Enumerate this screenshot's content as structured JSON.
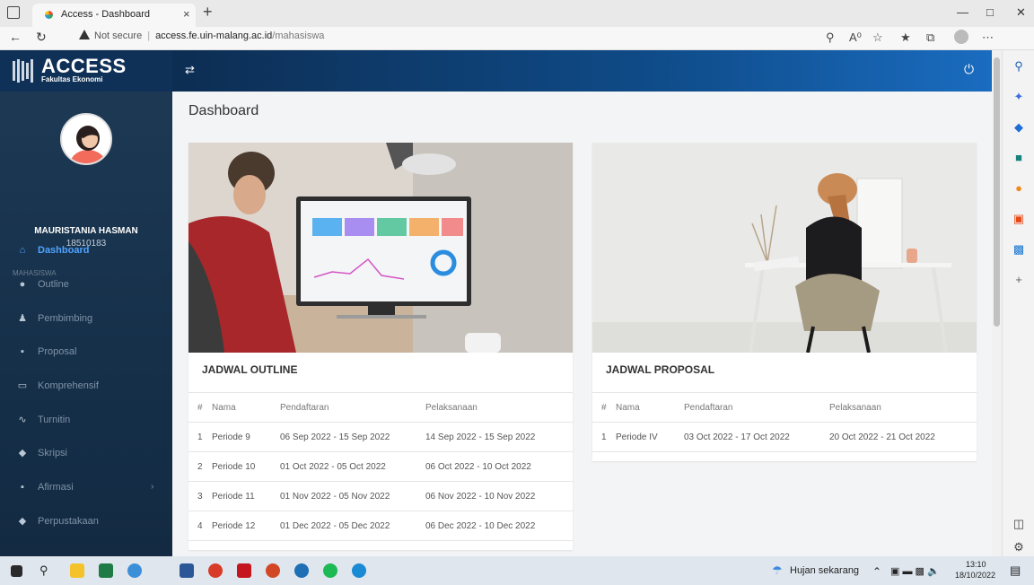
{
  "browser": {
    "tab_title": "Access - Dashboard",
    "new_tab": "+",
    "close_tab": "×",
    "not_secure": "Not secure",
    "url_host": "access.fe.uin-malang.ac.id",
    "url_path": "/mahasiswa"
  },
  "app": {
    "logo_title": "ACCESS",
    "logo_subtitle": "Fakultas Ekonomi",
    "page_title": "Dashboard"
  },
  "user": {
    "name": "MAURISTANIA HASMAN",
    "id": "18510183"
  },
  "sidebar": {
    "section_label": "MAHASISWA",
    "items": [
      {
        "label": "Dashboard",
        "icon": "home-icon",
        "glyph": "⌂"
      },
      {
        "label": "Outline",
        "icon": "circle-icon",
        "glyph": "●"
      },
      {
        "label": "Pembimbing",
        "icon": "user-icon",
        "glyph": "♟"
      },
      {
        "label": "Proposal",
        "icon": "document-icon",
        "glyph": "▪"
      },
      {
        "label": "Komprehensif",
        "icon": "monitor-icon",
        "glyph": "▭"
      },
      {
        "label": "Turnitin",
        "icon": "activity-icon",
        "glyph": "∿"
      },
      {
        "label": "Skripsi",
        "icon": "graduation-icon",
        "glyph": "◆"
      },
      {
        "label": "Afirmasi",
        "icon": "file-icon",
        "glyph": "▪"
      },
      {
        "label": "Perpustakaan",
        "icon": "book-icon",
        "glyph": "◆"
      }
    ]
  },
  "outline_card": {
    "title": "JADWAL OUTLINE",
    "headers": [
      "#",
      "Nama",
      "Pendaftaran",
      "Pelaksanaan"
    ],
    "rows": [
      [
        "1",
        "Periode 9",
        "06 Sep 2022 - 15 Sep 2022",
        "14 Sep 2022 - 15 Sep 2022"
      ],
      [
        "2",
        "Periode 10",
        "01 Oct 2022 - 05 Oct 2022",
        "06 Oct 2022 - 10 Oct 2022"
      ],
      [
        "3",
        "Periode 11",
        "01 Nov 2022 - 05 Nov 2022",
        "06 Nov 2022 - 10 Nov 2022"
      ],
      [
        "4",
        "Periode 12",
        "01 Dec 2022 - 05 Dec 2022",
        "06 Dec 2022 - 10 Dec 2022"
      ]
    ]
  },
  "proposal_card": {
    "title": "JADWAL PROPOSAL",
    "headers": [
      "#",
      "Nama",
      "Pendaftaran",
      "Pelaksanaan"
    ],
    "rows": [
      [
        "1",
        "Periode IV",
        "03 Oct 2022 - 17 Oct 2022",
        "20 Oct 2022 - 21 Oct 2022"
      ]
    ]
  },
  "taskbar": {
    "weather": "Hujan sekarang",
    "time": "13:10",
    "date": "18/10/2022"
  },
  "colors": {
    "sidebar_bg": "#17324c",
    "topbar_accent": "#1a6cc0",
    "active_menu": "#4fa3ff"
  }
}
